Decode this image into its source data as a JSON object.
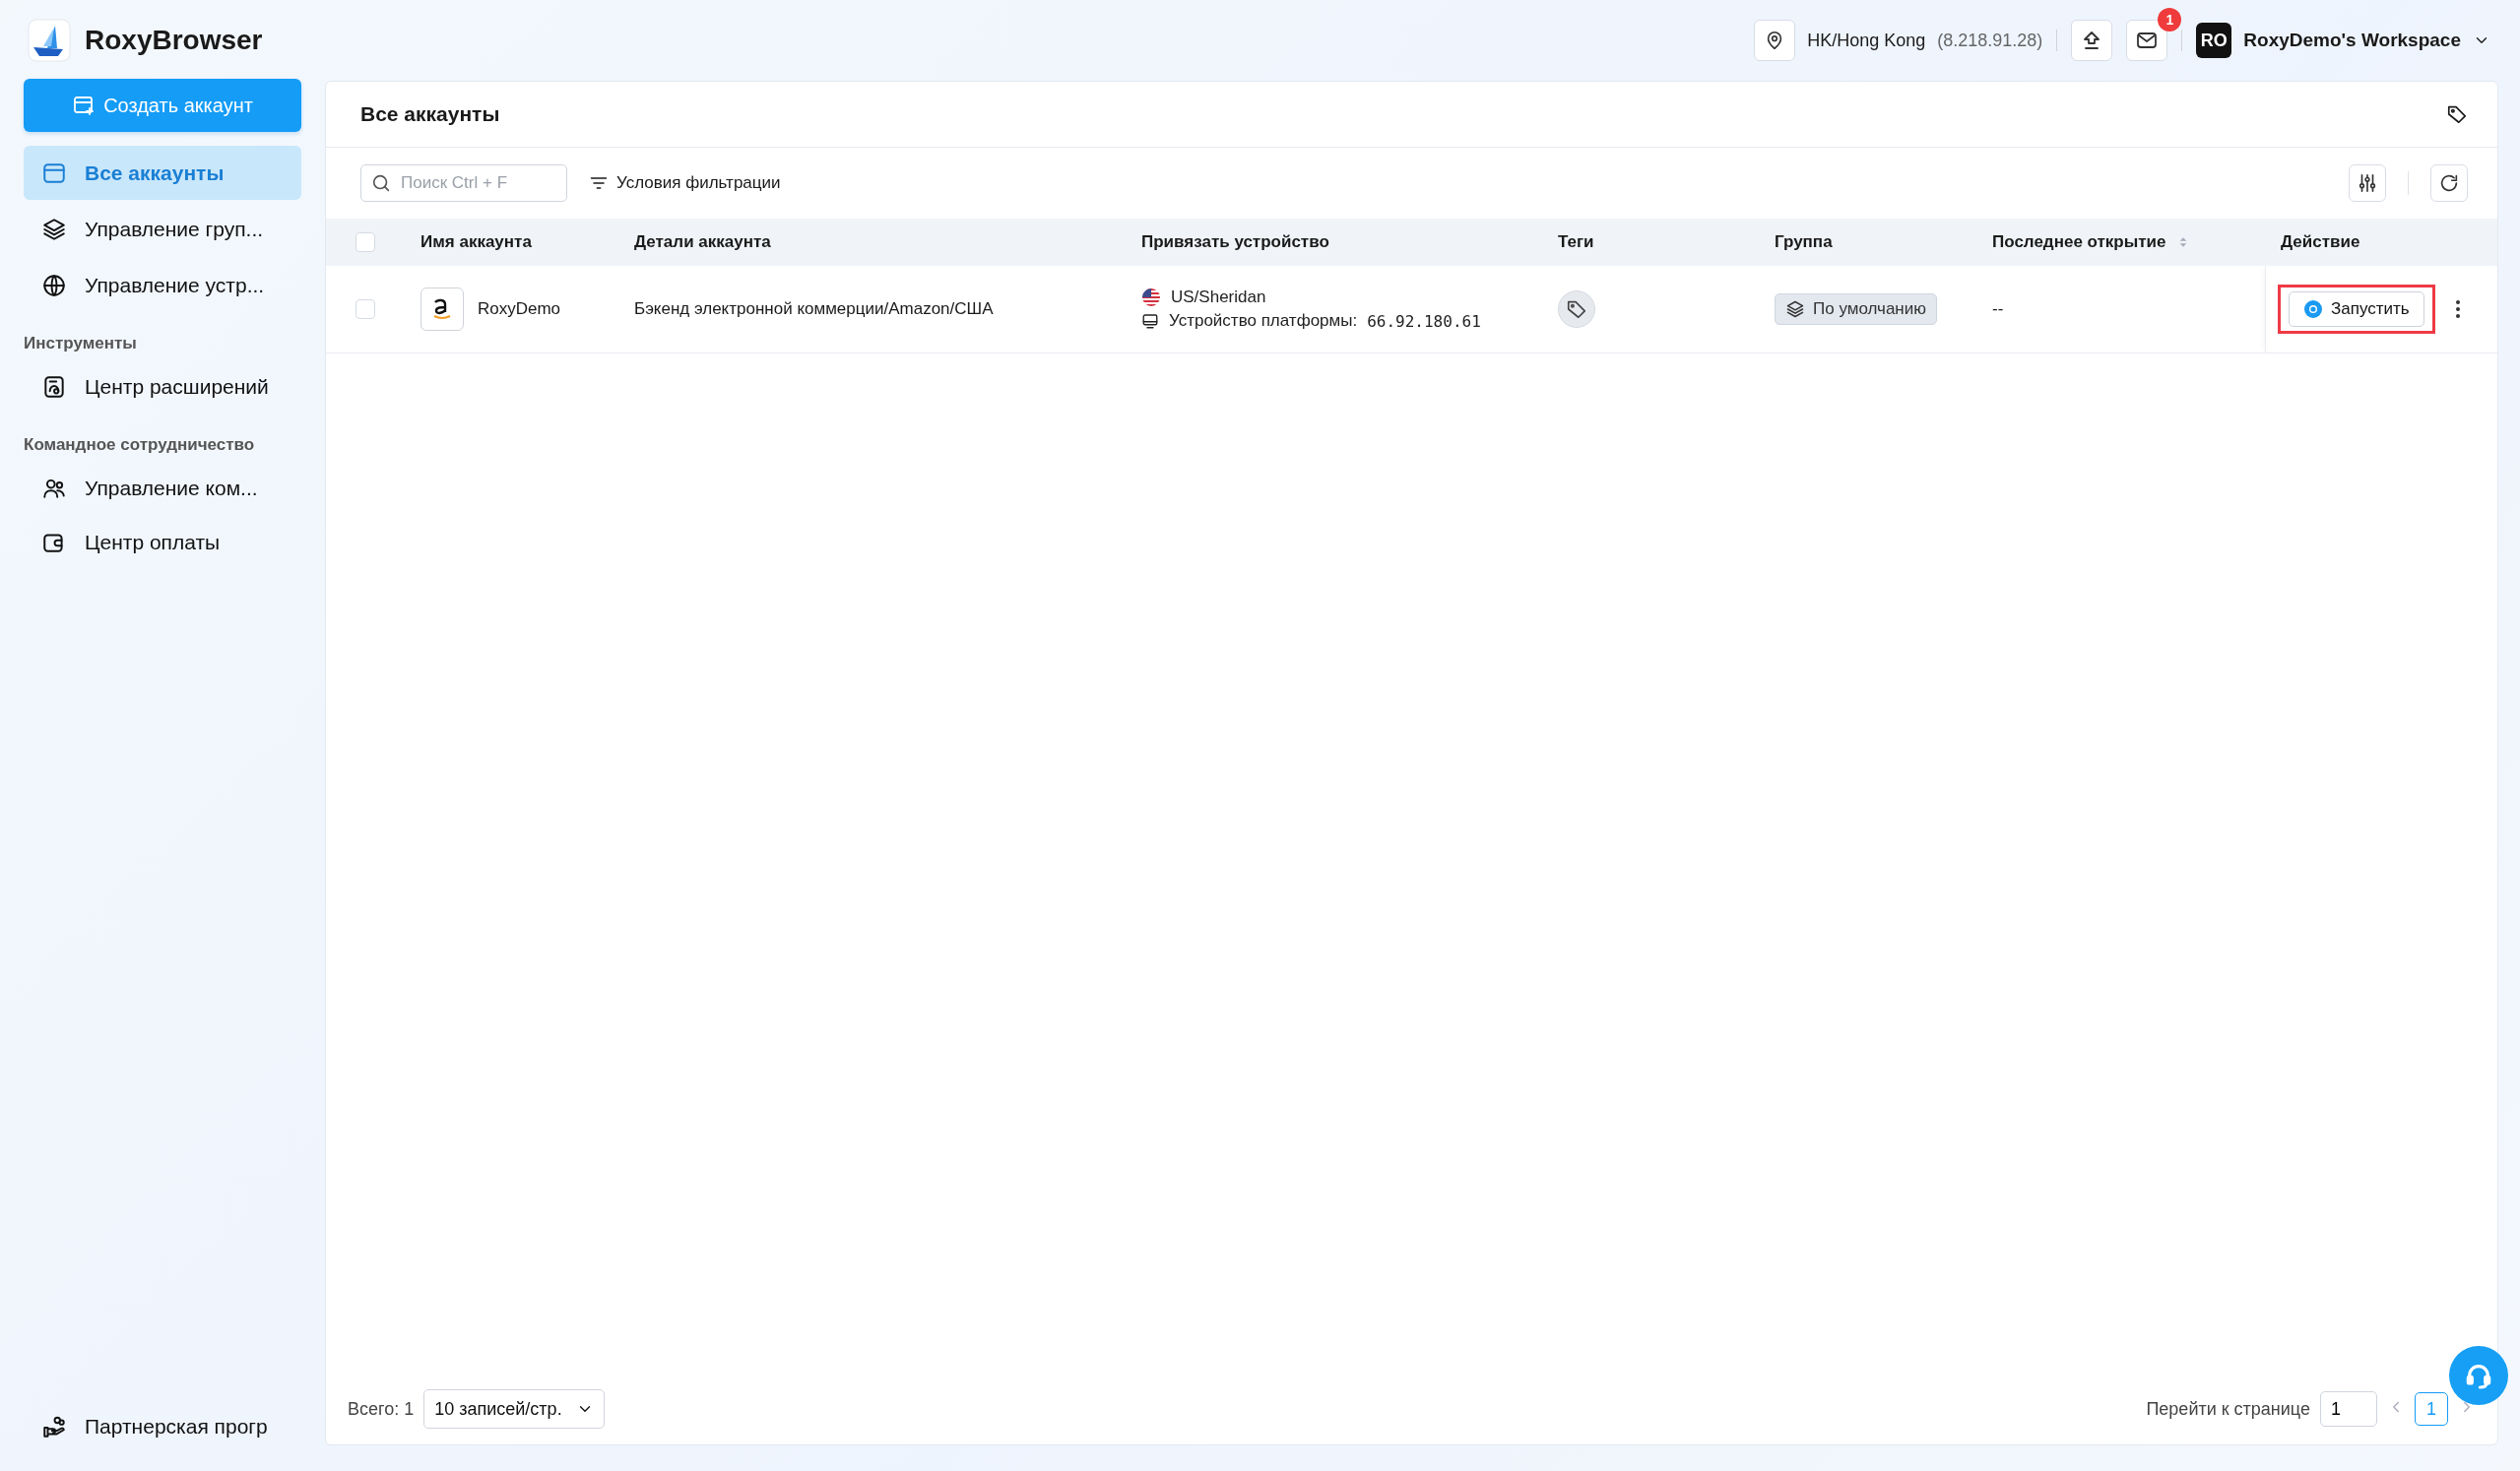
{
  "app": {
    "name": "RoxyBrowser"
  },
  "sidebar": {
    "create_button": "Создать аккаунт",
    "nav": [
      {
        "label": "Все аккаунты",
        "selected": true
      },
      {
        "label": "Управление груп...",
        "selected": false
      },
      {
        "label": "Управление устр...",
        "selected": false
      }
    ],
    "sections": [
      {
        "heading": "Инструменты",
        "items": [
          {
            "label": "Центр расширений",
            "selected": false
          }
        ]
      },
      {
        "heading": "Командное сотрудничество",
        "items": [
          {
            "label": "Управление ком...",
            "selected": false
          },
          {
            "label": "Центр оплаты",
            "selected": false
          }
        ]
      }
    ],
    "footer_item": {
      "label": "Партнерская прогр"
    }
  },
  "topbar": {
    "location": {
      "region": "HK/Hong Kong",
      "ip": "(8.218.91.28)"
    },
    "mail_badge": "1",
    "workspace": {
      "avatar": "RO",
      "name": "RoxyDemo's Workspace"
    }
  },
  "panel": {
    "title": "Все аккаунты",
    "search": {
      "placeholder": "Поиск Ctrl + F"
    },
    "filter_button": "Условия фильтрации",
    "table": {
      "select_all": {
        "checked": false
      },
      "columns": [
        {
          "label": "Имя аккаунта",
          "sortable": false
        },
        {
          "label": "Детали аккаунта",
          "sortable": false
        },
        {
          "label": "Привязать устройство",
          "sortable": false
        },
        {
          "label": "Теги",
          "sortable": false
        },
        {
          "label": "Группа",
          "sortable": false
        },
        {
          "label": "Последнее открытие",
          "sortable": true
        },
        {
          "label": "Действие",
          "sortable": false
        }
      ],
      "rows": [
        {
          "checked": false,
          "name": "RoxyDemo",
          "details": "Бэкенд электронной коммерции/Amazon/США",
          "location": "US/Sheridan",
          "device_label": "Устройство платформы:",
          "device_ip": "66.92.180.61",
          "group": "По умолчанию",
          "last_opened": "--",
          "action": "Запустить",
          "action_highlighted": true
        }
      ]
    },
    "footer": {
      "total": "Всего: 1",
      "page_size": "10 записей/стр.",
      "goto_label": "Перейти к странице",
      "goto_value": "1",
      "pages": [
        {
          "label": "1",
          "selected": true
        }
      ]
    }
  }
}
